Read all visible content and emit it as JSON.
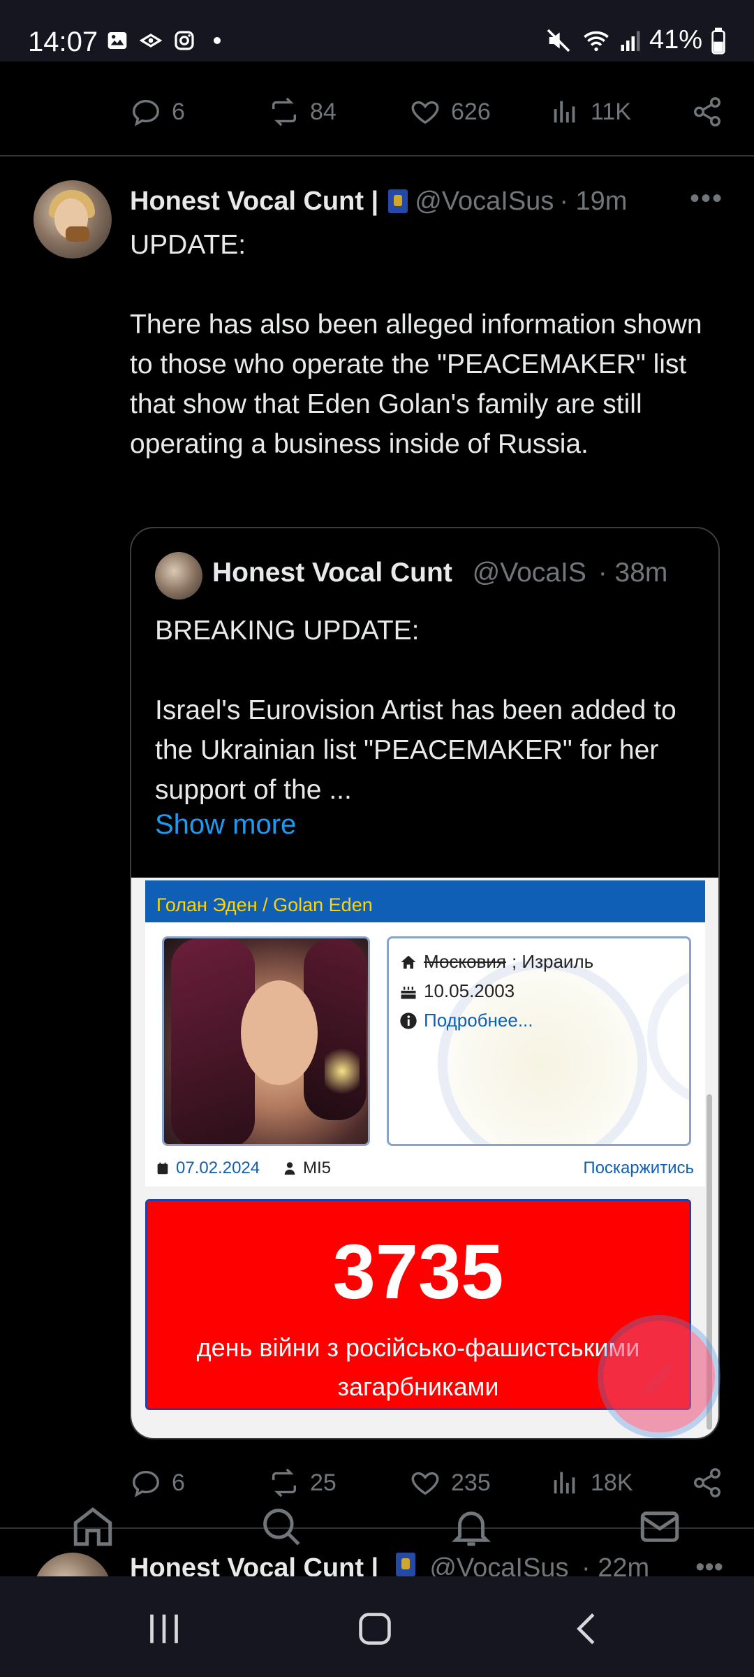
{
  "status_bar": {
    "time": "14:07",
    "battery": "41%",
    "icons": [
      "gallery-icon",
      "cast-icon",
      "instagram-icon",
      "mute-icon",
      "wifi-icon",
      "signal-icon",
      "battery-icon"
    ]
  },
  "prev_tweet_actions": {
    "replies": "6",
    "retweets": "84",
    "likes": "626",
    "views": "11K"
  },
  "tweet": {
    "name": "Honest Vocal Cunt |",
    "handle": "@VocaISus",
    "time": "· 19m",
    "more": "•••",
    "text": "UPDATE:\n\nThere has also been alleged information shown to those who operate the \"PEACEMAKER\" list that show that Eden Golan's family are still operating a business inside of Russia."
  },
  "quote": {
    "name": "Honest Vocal Cunt",
    "handle": "@VocaIS",
    "time": "· 38m",
    "text": "BREAKING UPDATE:\n\nIsrael's Eurovision Artist has been added to the Ukrainian list \"PEACEMAKER\" for her support of the ...",
    "show_more": "Show more",
    "card": {
      "title": "Голан Эден / Golan Eden",
      "country_struck": "Московия",
      "country": "; Израиль",
      "dob": "10.05.2003",
      "details_link": "Подробнее...",
      "added_date": "07.02.2024",
      "added_by": "MI5",
      "report_link": "Поскаржитись",
      "war_day": "3735",
      "war_text": "день війни з російсько-фашистськими загарбниками"
    }
  },
  "tweet_actions": {
    "replies": "6",
    "retweets": "25",
    "likes": "235",
    "views": "18K"
  },
  "next_tweet": {
    "name": "Honest Vocal Cunt |",
    "handle": "@VocaISus",
    "time": "· 22m",
    "more": "•••"
  },
  "tabs": [
    "home-icon",
    "search-icon",
    "notifications-icon",
    "messages-icon"
  ],
  "colors": {
    "accent": "#1d9bf0",
    "muted": "#71767b",
    "card_header": "#0f5fb6",
    "war_red": "#ff0000"
  }
}
